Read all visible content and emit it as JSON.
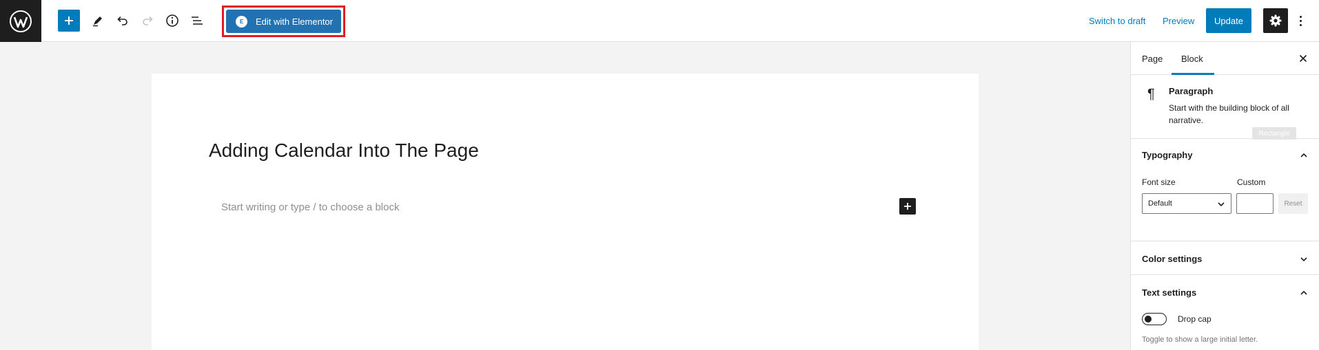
{
  "toolbar": {
    "logo_icon": "wordpress-logo",
    "add_block_icon": "plus-icon",
    "tools_icon": "pencil-icon",
    "undo_icon": "undo-icon",
    "redo_icon": "redo-icon",
    "details_icon": "info-icon",
    "outline_icon": "list-view-icon",
    "elementor_label": "Edit with Elementor",
    "elementor_badge": "E",
    "switch_to_draft": "Switch to draft",
    "preview": "Preview",
    "update": "Update",
    "settings_icon": "gear-icon",
    "more_icon": "vertical-ellipsis-icon",
    "highlight_color": "#e31b23",
    "accent_color": "#007cba"
  },
  "editor": {
    "title": "Adding Calendar Into The Page",
    "placeholder": "Start writing or type / to choose a block"
  },
  "sidebar": {
    "tabs": [
      "Page",
      "Block"
    ],
    "active_tab": "Block",
    "block": {
      "icon": "pilcrow-icon",
      "name": "Paragraph",
      "description": "Start with the building block of all narrative.",
      "tooltip": "Rectangle"
    },
    "typography": {
      "heading": "Typography",
      "font_size_label": "Font size",
      "custom_label": "Custom",
      "font_size_value": "Default",
      "custom_value": "",
      "reset_label": "Reset"
    },
    "color_settings": {
      "heading": "Color settings"
    },
    "text_settings": {
      "heading": "Text settings",
      "drop_cap_label": "Drop cap",
      "drop_cap_on": false,
      "drop_cap_help": "Toggle to show a large initial letter."
    }
  }
}
